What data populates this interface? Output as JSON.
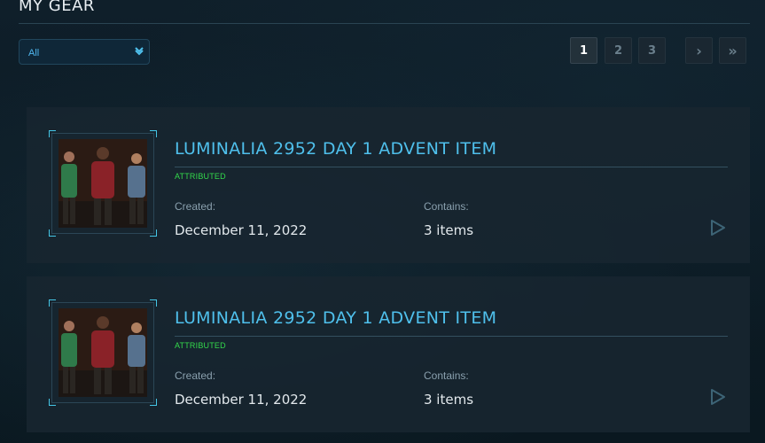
{
  "page": {
    "title": "MY GEAR"
  },
  "filter": {
    "selected": "All"
  },
  "pagination": {
    "pages": [
      "1",
      "2",
      "3"
    ],
    "current": "1",
    "next_symbol": "›",
    "last_symbol": "»"
  },
  "labels": {
    "created": "Created:",
    "contains": "Contains:"
  },
  "items": [
    {
      "title": "LUMINALIA 2952 DAY 1 ADVENT ITEM",
      "status": "ATTRIBUTED",
      "created": "December 11, 2022",
      "contains": "3 items",
      "thumbnail": "three-figures-holiday-sweaters"
    },
    {
      "title": "LUMINALIA 2952 DAY 1 ADVENT ITEM",
      "status": "ATTRIBUTED",
      "created": "December 11, 2022",
      "contains": "3 items",
      "thumbnail": "three-figures-holiday-sweaters"
    }
  ],
  "colors": {
    "accent": "#4fc0ec",
    "status_green": "#33d94b",
    "background": "#0b1a24",
    "card": "#18262f"
  },
  "icons": {
    "filter_dropdown": "chevron-down-icon",
    "item_action": "play-icon"
  }
}
